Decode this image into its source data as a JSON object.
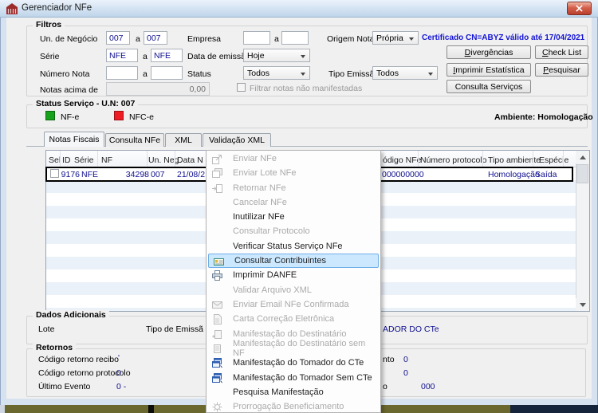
{
  "window": {
    "title": "Gerenciador NFe"
  },
  "filtros": {
    "title": "Filtros",
    "fields": {
      "un_negocio": {
        "label": "Un. de Negócio",
        "from": "007",
        "sep": "a",
        "to": "007"
      },
      "serie": {
        "label": "Série",
        "from": "NFE",
        "sep": "a",
        "to": "NFE"
      },
      "numero_nota": {
        "label": "Número Nota",
        "from": "",
        "sep": "a",
        "to": ""
      },
      "notas_acima": {
        "label": "Notas acima de",
        "value": "0,00"
      },
      "empresa": {
        "label": "Empresa",
        "from": "",
        "sep": "a",
        "to": ""
      },
      "data_emissao": {
        "label": "Data de emissão",
        "value": "Hoje"
      },
      "status": {
        "label": "Status",
        "value": "Todos"
      },
      "origem": {
        "label": "Origem Nota",
        "value": "Própria"
      },
      "tipo_emissao": {
        "label": "Tipo Emissão",
        "value": "Todos"
      }
    },
    "certificado": "Certificado CN=ABYZ válido até 17/04/2021",
    "filtrar_checkbox_label": "Filtrar notas não manifestadas",
    "buttons": [
      {
        "label": "Divergências",
        "key": "D"
      },
      {
        "label": "Check List",
        "key": "C"
      },
      {
        "label": "Imprimir Estatística",
        "key": "I"
      },
      {
        "label": "Pesquisar",
        "key": "P"
      },
      {
        "label": "Consulta Serviços",
        "key": ""
      }
    ]
  },
  "status_servico": {
    "title": "Status Serviço - U.N: 007",
    "nfe_label": "NF-e",
    "nfce_label": "NFC-e",
    "ambiente": "Ambiente: Homologação"
  },
  "tabs": [
    {
      "label": "Notas Fiscais"
    },
    {
      "label": "Consulta NFe"
    },
    {
      "label": "XML"
    },
    {
      "label": "Validação XML"
    }
  ],
  "grid": {
    "headers": [
      "Sel",
      "ID",
      "Série",
      "NF",
      "Un. Neg.",
      "Data N",
      "ódigo NFe",
      "Número protocolo",
      "Tipo ambiente",
      "Espécie"
    ],
    "row": {
      "id": "9176",
      "serie": "NFE",
      "nf": "34298",
      "un_neg": "007",
      "data": "21/08/2",
      "codigo_nfe": "000000000",
      "numero_protocolo": "",
      "tipo_ambiente": "Homologação",
      "especie": "Saída"
    }
  },
  "menu": {
    "items": [
      {
        "label": "Enviar NFe"
      },
      {
        "label": "Enviar Lote NFe"
      },
      {
        "label": "Retornar NFe"
      },
      {
        "label": "Cancelar NFe"
      },
      {
        "label": "Inutilizar NFe"
      },
      {
        "label": "Consultar Protocolo"
      },
      {
        "label": "Verificar Status Serviço NFe"
      },
      {
        "label": "Consultar Contribuintes"
      },
      {
        "label": "Imprimir DANFE"
      },
      {
        "label": "Validar Arquivo XML"
      },
      {
        "label": "Enviar Email NFe Confirmada"
      },
      {
        "label": "Carta Correção Eletrônica"
      },
      {
        "label": "Manifestação do Destinatário"
      },
      {
        "label": "Manifestação do Destinatário sem NF"
      },
      {
        "label": "Manifestação do Tomador do CTe"
      },
      {
        "label": "Manifestação do Tomador Sem CTe"
      },
      {
        "label": "Pesquisa Manifestação"
      },
      {
        "label": "Prorrogação Beneficiamento"
      }
    ],
    "icons": [
      "send-nfe-icon",
      "send-lote-icon",
      "return-nfe-icon",
      "contribuintes-card-icon",
      "printer-icon",
      "email-icon",
      "letter-page-icon",
      "manifest-page-icon",
      "cte-windows-icon",
      "gear-icon"
    ]
  },
  "dados_adicionais": {
    "title": "Dados Adicionais",
    "lote_label": "Lote",
    "tipo_emissao_label": "Tipo de Emissã",
    "value_fragment": "ADOR DO CTe"
  },
  "retornos": {
    "title": "Retornos",
    "rows": [
      {
        "label": "Código retorno recibo",
        "value": "'"
      },
      {
        "label": "Código retorno protocolo",
        "value": "0"
      },
      {
        "label": "Último Evento",
        "value": "0 -"
      }
    ],
    "right_fragments": [
      {
        "label": "nto",
        "value": "0"
      },
      {
        "label": "",
        "value": "0"
      },
      {
        "label": "o",
        "value": "000"
      }
    ]
  },
  "colors": {
    "nfe_status_green": "#17a21b",
    "nfce_status_red": "#ee1c25",
    "certificate_text": "#1515d6",
    "data_text_navy": "#10108f",
    "menu_highlight_bg": "#cbe8ff",
    "menu_highlight_border": "#70aee8",
    "titlebar_blue": "#bfd5ea",
    "bottom_strip_olive": "#6b682f",
    "bottom_strip_navy": "#15233b"
  }
}
